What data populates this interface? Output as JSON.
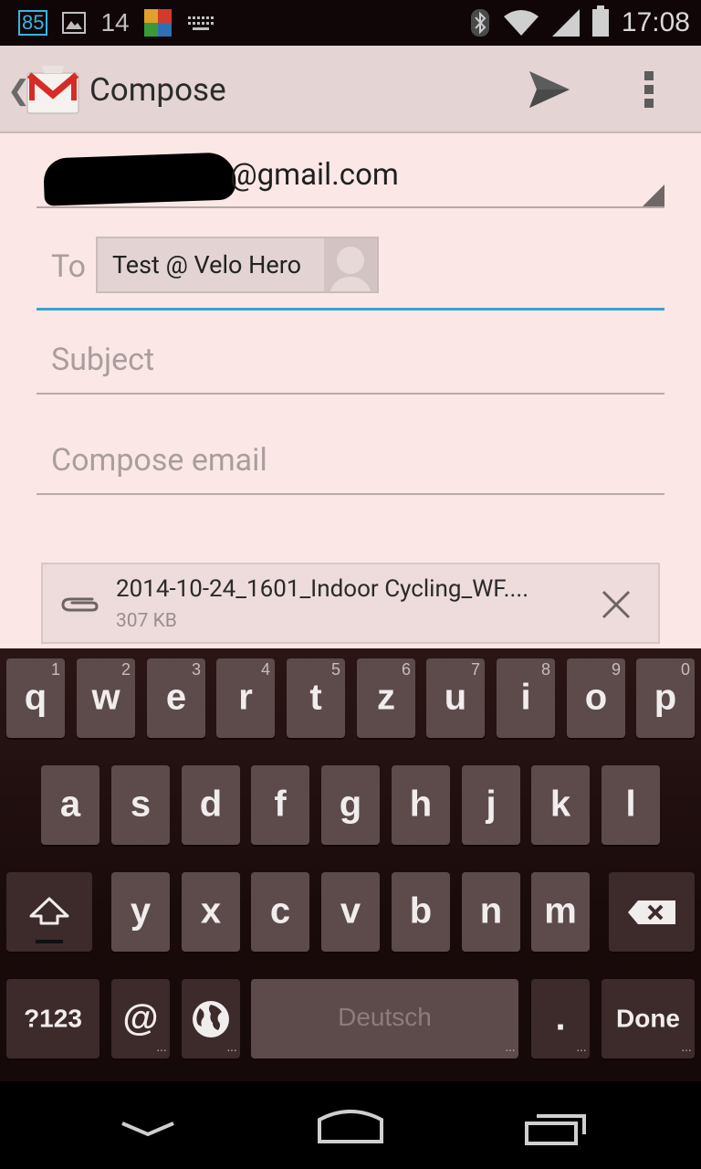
{
  "status_bar": {
    "notification_count": "85",
    "notification_number": "14",
    "time": "17:08"
  },
  "action_bar": {
    "title": "Compose"
  },
  "compose": {
    "from_domain": "@gmail.com",
    "to_label": "To",
    "recipient_chip": "Test @ Velo Hero",
    "subject_placeholder": "Subject",
    "body_placeholder": "Compose email",
    "attachment": {
      "name": "2014-10-24_1601_Indoor Cycling_WF....",
      "size": "307 KB"
    }
  },
  "keyboard": {
    "row1": [
      {
        "label": "q",
        "hint": "1"
      },
      {
        "label": "w",
        "hint": "2"
      },
      {
        "label": "e",
        "hint": "3"
      },
      {
        "label": "r",
        "hint": "4"
      },
      {
        "label": "t",
        "hint": "5"
      },
      {
        "label": "z",
        "hint": "6"
      },
      {
        "label": "u",
        "hint": "7"
      },
      {
        "label": "i",
        "hint": "8"
      },
      {
        "label": "o",
        "hint": "9"
      },
      {
        "label": "p",
        "hint": "0"
      }
    ],
    "row2": [
      "a",
      "s",
      "d",
      "f",
      "g",
      "h",
      "j",
      "k",
      "l"
    ],
    "row3": [
      "y",
      "x",
      "c",
      "v",
      "b",
      "n",
      "m"
    ],
    "symbols_key": "?123",
    "at_key": "@",
    "space_label": "Deutsch",
    "period_key": ".",
    "done_key": "Done"
  }
}
